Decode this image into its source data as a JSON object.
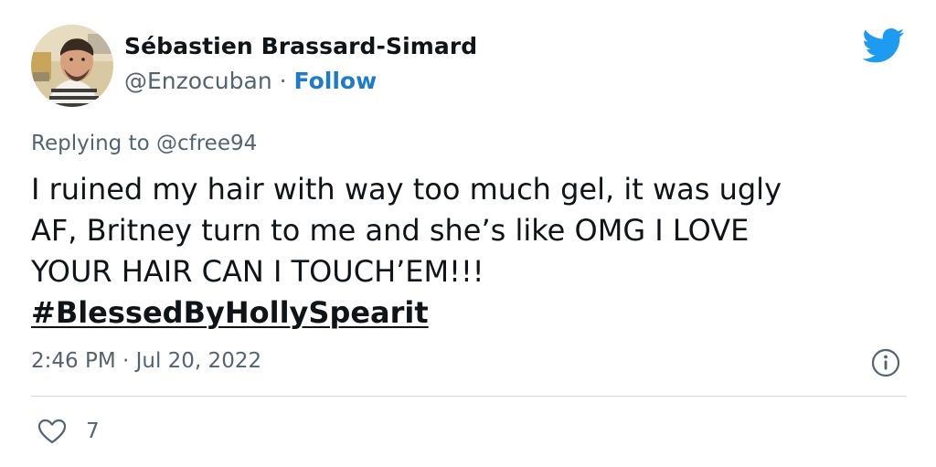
{
  "tweet": {
    "author": {
      "display_name": "Sébastien Brassard-Simard",
      "handle": "@Enzocuban",
      "separator": " · ",
      "follow_label": "Follow"
    },
    "replying_to": {
      "prefix": "Replying to ",
      "mention": "@cfree94"
    },
    "body_lines": [
      "I ruined my hair with way too much gel, it was ugly",
      "AF, Britney turn to me and she’s like OMG I LOVE",
      "YOUR HAIR CAN I TOUCH’EM!!!"
    ],
    "hashtag": "#BlessedByHollySpearit",
    "timestamp": "2:46 PM · Jul 20, 2022",
    "like_count": "7"
  },
  "icons": {
    "brand": "twitter-bird-icon",
    "info": "info-icon",
    "like": "heart-icon"
  },
  "colors": {
    "brand_blue": "#1d9bf0",
    "link_blue": "#1d7bc7",
    "text": "#0f1419",
    "secondary_text": "#536471",
    "divider": "#cfd9de"
  }
}
